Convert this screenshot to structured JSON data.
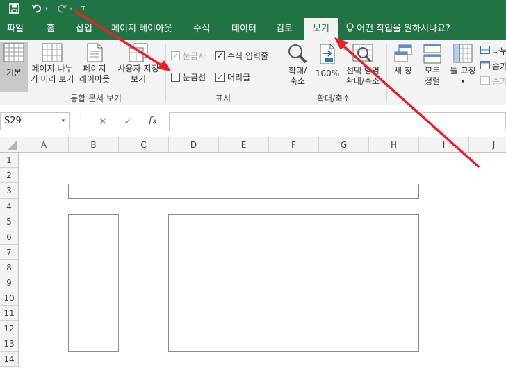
{
  "quick_access": {
    "save_icon": "save-icon",
    "undo_icon": "undo-icon",
    "redo_icon": "redo-icon",
    "customize_icon": "customize-qat-icon"
  },
  "tabs": [
    {
      "label": "파일",
      "active": false
    },
    {
      "label": "홈",
      "active": false
    },
    {
      "label": "삽입",
      "active": false
    },
    {
      "label": "페이지 레이아웃",
      "active": false
    },
    {
      "label": "수식",
      "active": false
    },
    {
      "label": "데이터",
      "active": false
    },
    {
      "label": "검토",
      "active": false
    },
    {
      "label": "보기",
      "active": true
    }
  ],
  "tell_me": "어떤 작업을 원하시나요?",
  "ribbon": {
    "workbook_views": {
      "normal": "기본",
      "page_break_line1": "페이지 나누",
      "page_break_line2": "기 미리 보기",
      "page_layout_line1": "페이지",
      "page_layout_line2": "레이아웃",
      "custom_line1": "사용자 지정",
      "custom_line2": "보기",
      "group_label": "통합 문서 보기"
    },
    "show": {
      "ruler": {
        "label": "눈금자",
        "checked": true,
        "disabled": true
      },
      "formula_bar": {
        "label": "수식 입력줄",
        "checked": true
      },
      "gridlines": {
        "label": "눈금선",
        "checked": false
      },
      "headings": {
        "label": "머리글",
        "checked": true
      },
      "group_label": "표시"
    },
    "zoom": {
      "zoom_line1": "확대/",
      "zoom_line2": "축소",
      "percent": "100%",
      "selection_line1": "선택 영역",
      "selection_line2": "확대/축소",
      "group_label": "확대/축소"
    },
    "window": {
      "new_window": "새 창",
      "arrange_line1": "모두",
      "arrange_line2": "정렬",
      "freeze": "틀 고정",
      "split": "나누",
      "hide": "숨기",
      "unhide": "숨기"
    }
  },
  "formula_bar": {
    "name_box": "S29",
    "cancel": "✕",
    "enter": "✓",
    "fx": "fx",
    "value": ""
  },
  "columns": [
    "A",
    "B",
    "C",
    "D",
    "E",
    "F",
    "G",
    "H",
    "I",
    "J"
  ],
  "rows": [
    "1",
    "2",
    "3",
    "4",
    "5",
    "6",
    "7",
    "8",
    "9",
    "10",
    "11",
    "12",
    "13",
    "14"
  ],
  "colors": {
    "excel_green": "#217346",
    "arrow_red": "#e8202a"
  }
}
